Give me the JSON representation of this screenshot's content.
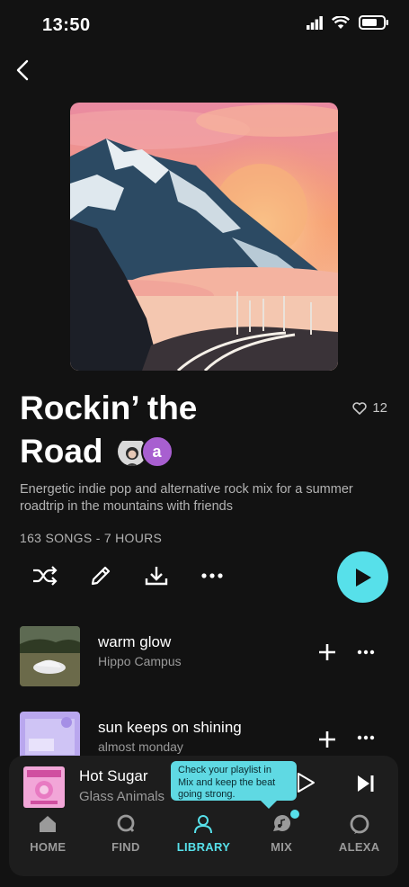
{
  "status_bar": {
    "time": "13:50"
  },
  "playlist": {
    "title_line1": "Rockin’ the",
    "title_line2": "Road",
    "likes": "12",
    "avatar_letter": "a",
    "description": "Energetic indie pop and alternative rock mix for a summer roadtrip in the mountains with friends",
    "meta": "163 SONGS - 7 HOURS"
  },
  "tracks": [
    {
      "title": "warm glow",
      "artist": "Hippo Campus"
    },
    {
      "title": "sun keeps on shining",
      "artist": "almost monday"
    }
  ],
  "now_playing": {
    "title": "Hot Sugar",
    "artist": "Glass Animals"
  },
  "tooltip": {
    "text": "Check your playlist in Mix and keep the beat going strong."
  },
  "nav": {
    "items": [
      {
        "label": "HOME",
        "icon": "home-icon"
      },
      {
        "label": "FIND",
        "icon": "search-icon"
      },
      {
        "label": "LIBRARY",
        "icon": "library-icon",
        "active": true
      },
      {
        "label": "MIX",
        "icon": "mix-icon"
      },
      {
        "label": "ALEXA",
        "icon": "alexa-icon"
      }
    ]
  },
  "colors": {
    "accent": "#57e0ea",
    "background": "#121212",
    "panel": "#1d1d1d"
  }
}
